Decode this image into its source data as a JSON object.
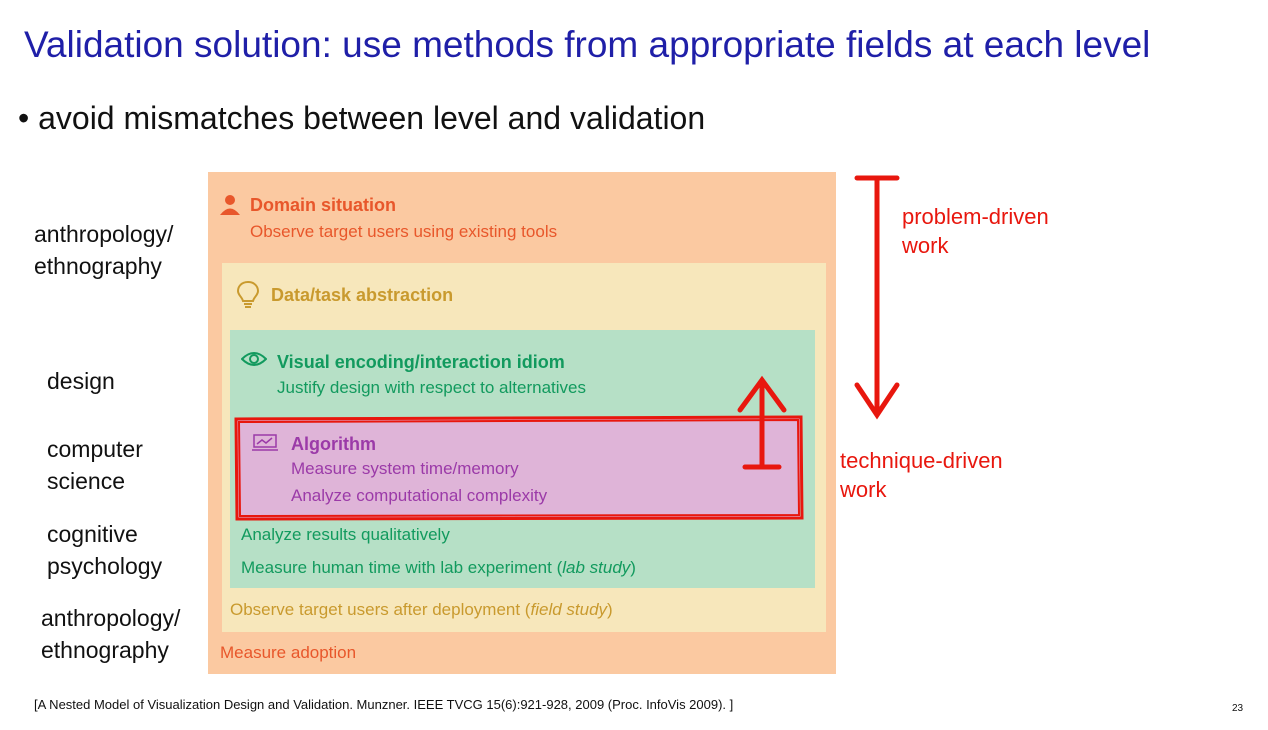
{
  "title": "Validation solution: use methods from appropriate fields at each level",
  "bullet": "avoid mismatches between level and validation",
  "fields": {
    "domain_top": [
      "anthropology/",
      "ethnography"
    ],
    "design": "design",
    "cs": [
      "computer",
      "science"
    ],
    "cogpsych": [
      "cognitive",
      "psychology"
    ],
    "domain_bottom": [
      "anthropology/",
      "ethnography"
    ]
  },
  "levels": {
    "domain": {
      "title": "Domain situation",
      "pre": "Observe target users using existing tools",
      "post": "Measure adoption",
      "color": "#e8572b",
      "icon": "person-icon"
    },
    "abstraction": {
      "title": "Data/task abstraction",
      "post_main": "Observe target users after deployment (",
      "post_em": "field study",
      "post_end": ")",
      "color": "#c99a2e",
      "icon": "lightbulb-icon"
    },
    "idiom": {
      "title": "Visual encoding/interaction idiom",
      "pre": "Justify design with respect to alternatives",
      "post1": "Analyze results qualitatively",
      "post2_main": "Measure human time with lab experiment (",
      "post2_em": "lab study",
      "post2_end": ")",
      "color": "#129a5e",
      "icon": "eye-icon"
    },
    "algorithm": {
      "title": "Algorithm",
      "line1": "Measure system time/memory",
      "line2": "Analyze computational complexity",
      "color": "#9b3aa8",
      "icon": "chart-icon"
    }
  },
  "annotations": {
    "problem": [
      "problem-driven",
      "work"
    ],
    "technique": [
      "technique-driven",
      "work"
    ],
    "color": "#e8170e"
  },
  "citation": "[A Nested Model of Visualization Design and Validation. Munzner.  IEEE TVCG 15(6):921-928, 2009 (Proc. InfoVis 2009). ]",
  "page_number": "23"
}
